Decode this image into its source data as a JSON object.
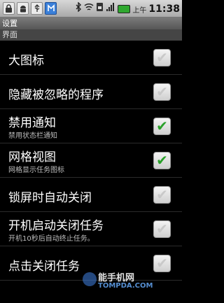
{
  "status_bar": {
    "left_icons": [
      "lock-icon",
      "android-icon",
      "usb-icon",
      "app-icon"
    ],
    "right_icons": [
      "bluetooth-icon",
      "wifi-icon",
      "sim-icon",
      "signal-icon",
      "battery-icon"
    ],
    "ampm": "上午",
    "time": "11:38"
  },
  "title": "设置",
  "category": "界面",
  "prefs": [
    {
      "title": "大图标",
      "checked": false
    },
    {
      "title": "隐藏被忽略的程序",
      "checked": false
    },
    {
      "title": "禁用通知",
      "summary": "禁用状态栏通知",
      "checked": true
    },
    {
      "title": "网格视图",
      "summary": "网格显示任务图标",
      "checked": true
    },
    {
      "title": "锁屏时自动关闭",
      "checked": false
    },
    {
      "title": "开机启动关闭任务",
      "summary": "开机10秒后自动终止任务。",
      "checked": false
    },
    {
      "title": "点击关闭任务",
      "checked": false
    }
  ],
  "watermark": {
    "line1": "能手机网",
    "line2": "TOMPDA.COM"
  },
  "colors": {
    "check_green": "#2aa12a",
    "background": "#000000",
    "title_bar": "#666666"
  }
}
